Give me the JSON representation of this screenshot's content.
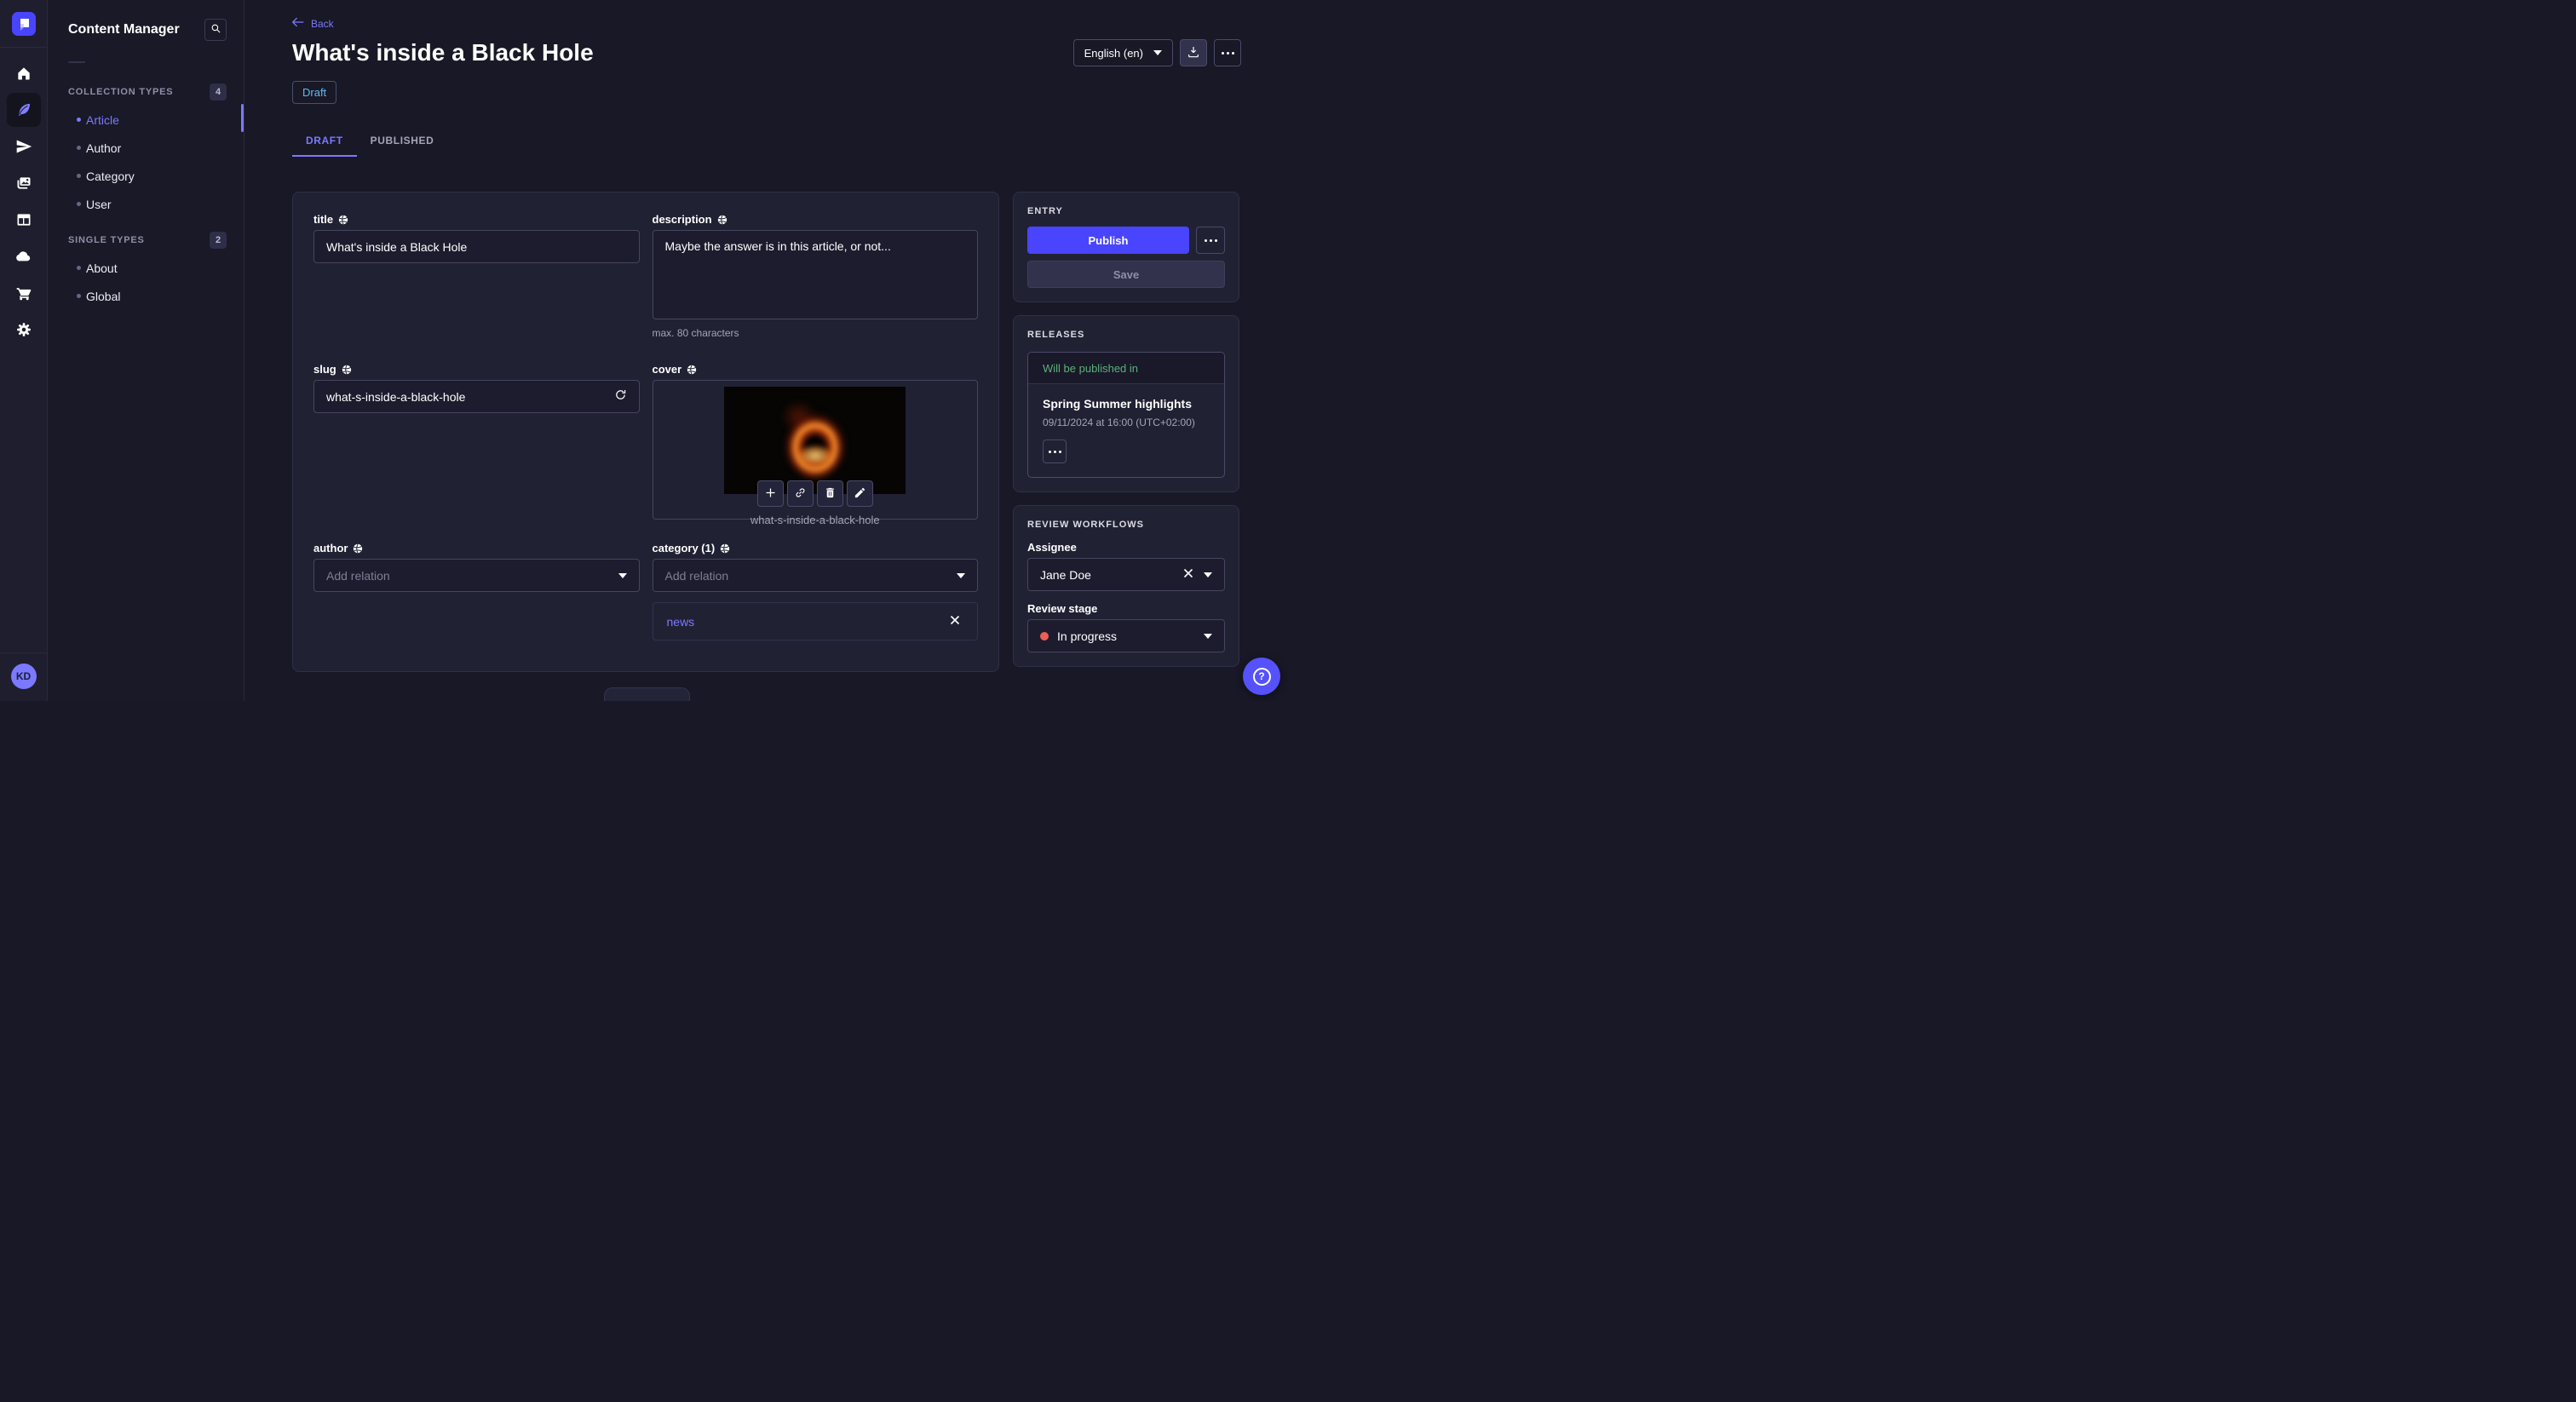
{
  "rail": {
    "icons": [
      "home",
      "content-manager-feather",
      "send-plane",
      "media-library",
      "content-type-builder",
      "cloud",
      "marketplace-cart",
      "settings-gear"
    ],
    "avatar_initials": "KD"
  },
  "sidebar": {
    "title": "Content Manager",
    "sections": [
      {
        "label": "COLLECTION TYPES",
        "count": "4",
        "items": [
          {
            "label": "Article"
          },
          {
            "label": "Author"
          },
          {
            "label": "Category"
          },
          {
            "label": "User"
          }
        ]
      },
      {
        "label": "SINGLE TYPES",
        "count": "2",
        "items": [
          {
            "label": "About"
          },
          {
            "label": "Global"
          }
        ]
      }
    ]
  },
  "header": {
    "back_label": "Back",
    "title": "What's inside a Black Hole",
    "status_badge": "Draft",
    "tabs": [
      {
        "label": "DRAFT"
      },
      {
        "label": "PUBLISHED"
      }
    ],
    "locale_value": "English (en)"
  },
  "form": {
    "title_field": {
      "label": "title",
      "value": "What's inside a Black Hole"
    },
    "description_field": {
      "label": "description",
      "value": "Maybe the answer is in this article, or not...",
      "hint": "max. 80 characters"
    },
    "slug_field": {
      "label": "slug",
      "value": "what-s-inside-a-black-hole"
    },
    "cover_field": {
      "label": "cover",
      "caption": "what-s-inside-a-black-hole"
    },
    "author_field": {
      "label": "author",
      "placeholder": "Add relation"
    },
    "category_field": {
      "label": "category (1)",
      "placeholder": "Add relation",
      "tag": "news"
    }
  },
  "entry_panel": {
    "title": "ENTRY",
    "publish_label": "Publish",
    "save_label": "Save"
  },
  "releases_panel": {
    "title": "RELEASES",
    "status": "Will be published in",
    "name": "Spring Summer highlights",
    "date": "09/11/2024 at 16:00 (UTC+02:00)"
  },
  "review_panel": {
    "title": "REVIEW WORKFLOWS",
    "assignee_label": "Assignee",
    "assignee_value": "Jane Doe",
    "stage_label": "Review stage",
    "stage_value": "In progress"
  },
  "colors": {
    "primary": "#4945ff",
    "primary_light": "#7b79ff",
    "draft_blue": "#66b7f1",
    "success_green": "#5cb176",
    "danger_red": "#ee5e52"
  }
}
